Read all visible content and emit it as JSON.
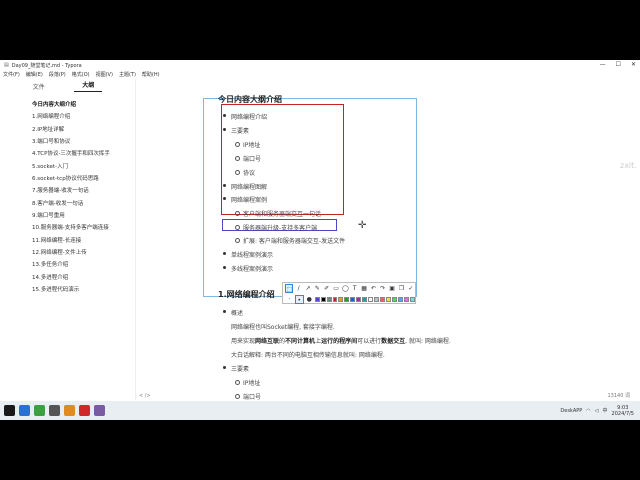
{
  "window": {
    "title": "Day09_随堂笔记.md - Typora"
  },
  "menu": [
    "文件(F)",
    "编辑(E)",
    "段落(P)",
    "格式(O)",
    "视图(V)",
    "主题(T)",
    "帮助(H)"
  ],
  "sidebar": {
    "tabs": [
      "文件",
      "大纲"
    ],
    "items": [
      "今日内容大纲介绍",
      "1.网络编程介绍",
      "2.IP地址详解",
      "3.端口号和协议",
      "4.TCP协议-三次握手和四次挥手",
      "5.socket-入门",
      "6.socket-tcp协议代码思路",
      "7.服务器端-收发一句话",
      "8.客户端-收发一句话",
      "9.端口号重用",
      "10.服务器端-支持多客户端连接",
      "11.网络编程-长连接",
      "12.网络编程-文件上传",
      "13.多任务介绍",
      "14.多进程介绍",
      "15.多进程代码演示"
    ]
  },
  "doc": {
    "heading1": "今日内容大纲介绍",
    "list": [
      "网络编程介绍",
      "三要素",
      "IP地址",
      "端口号",
      "协议",
      "网络编程图解",
      "网络编程案例",
      "客户端和服务器端交互一句话",
      "服务器端升级-支持多客户端",
      "扩展: 客户端和服务器端交互-发送文件",
      "单线程案例演示",
      "多线程案例演示"
    ],
    "heading2": "1.网络编程介绍",
    "section": {
      "overview": "概述",
      "p1": "网络编程也叫Socket编程, 套接字编程.",
      "p2_a": "用来实现",
      "p2_b": "网络互联",
      "p2_c": "的",
      "p2_d": "不同计算机",
      "p2_e": "上",
      "p2_f": "运行的程序间",
      "p2_g": "可以进行",
      "p2_h": "数据交互",
      "p2_i": ", 就叫: 网络编程.",
      "p3": "大白话解释: 两台不同的电脑互相传输信息就叫: 网络编程.",
      "three": "三要素",
      "ip": "IP地址",
      "port": "端口号"
    },
    "watermark": "zxit."
  },
  "statusbar": {
    "left": "< />",
    "right": "13140 词"
  },
  "taskbar": {
    "tray_app": "DeskAPP",
    "ime": "中",
    "time": "9:03",
    "date": "2024/7/5"
  },
  "colors": {
    "frame_red": "#c42424",
    "frame_blue": "#7fb8e0",
    "frame_purple": "#4848c8"
  }
}
